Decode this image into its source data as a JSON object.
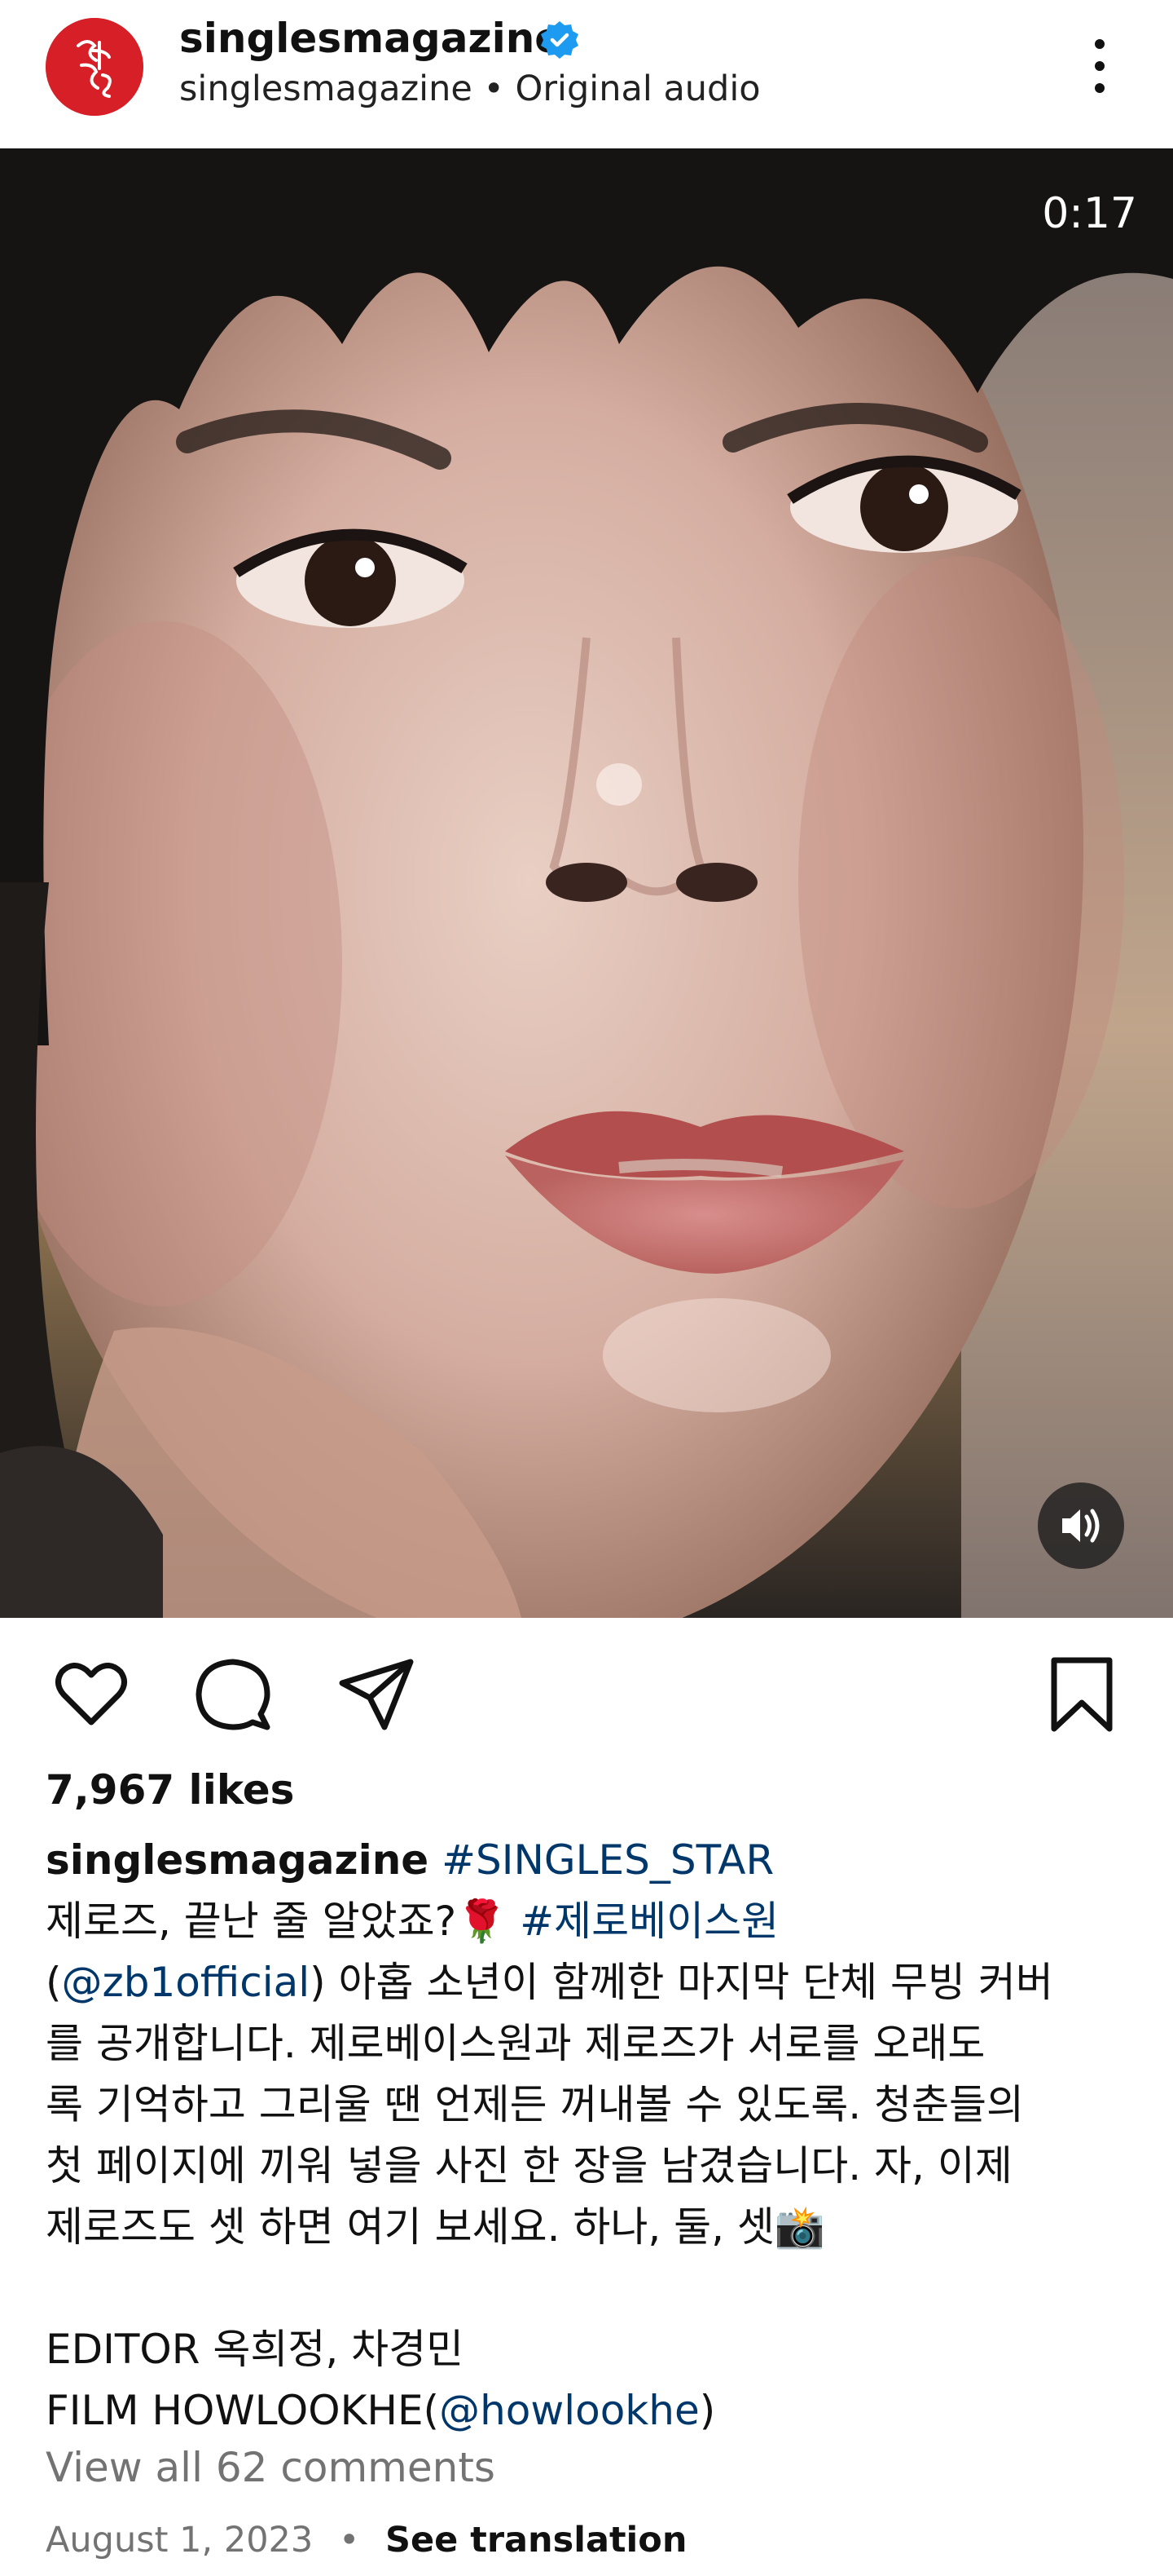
{
  "header": {
    "username": "singlesmagazine",
    "subline": "singlesmagazine • Original audio",
    "avatar_color": "#d61f26",
    "verified_color": "#1d9bf0",
    "icons": {
      "verified": "verified-badge-icon",
      "more": "more-vertical-icon"
    }
  },
  "media": {
    "timer": "0:17",
    "audio_icon": "volume-icon"
  },
  "actions": {
    "icons": [
      "heart-icon",
      "comment-icon",
      "share-icon",
      "bookmark-icon"
    ]
  },
  "post": {
    "likes": "7,967 likes",
    "caption": {
      "author": "singlesmagazine",
      "hashtag1": "#SINGLES_STAR",
      "line2_text": "제로즈, 끝난 줄 알았죠?🌹 ",
      "hashtag2": "#제로베이스원",
      "line3_open": "(",
      "mention1": "@zb1official",
      "line3_rest": ") 아홉 소년이 함께한 마지막 단체 무빙 커버",
      "line4": "를 공개합니다. 제로베이스원과 제로즈가 서로를 오래도",
      "line5": "록 기억하고 그리울 땐 언제든 꺼내볼 수 있도록. 청춘들의",
      "line6": "첫 페이지에 끼워 넣을 사진 한 장을 남겼습니다. 자, 이제",
      "line7": "제로즈도 셋 하면 여기 보세요. 하나, 둘, 셋📸",
      "editor": "EDITOR 옥희정, 차경민",
      "film_prefix": "FILM HOWLOOKHE(",
      "mention2": "@howlookhe",
      "film_suffix": ")"
    },
    "view_all_comments": "View all 62 comments",
    "date": "August 1, 2023",
    "dot": "•",
    "see_translation": "See translation"
  },
  "colors": {
    "link": "#00376b",
    "muted": "#737373",
    "text": "#111111"
  }
}
